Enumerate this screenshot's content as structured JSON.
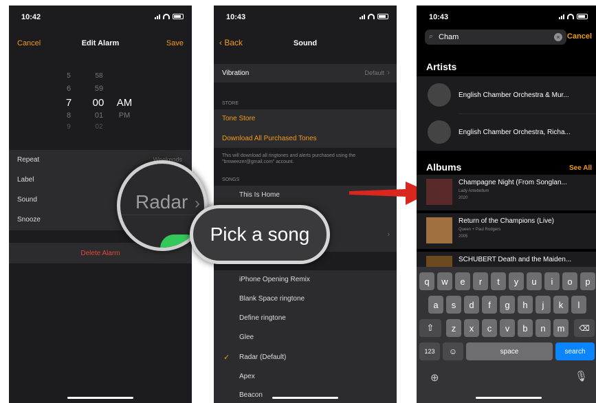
{
  "p1": {
    "time": "10:42",
    "cancel": "Cancel",
    "title": "Edit Alarm",
    "save": "Save",
    "picker": {
      "hours": [
        "5",
        "6",
        "7",
        "8",
        "9"
      ],
      "minutes": [
        "58",
        "59",
        "00",
        "01",
        "02"
      ],
      "ampm": [
        "AM",
        "PM"
      ]
    },
    "rows": [
      {
        "label": "Repeat",
        "value": "Weekends"
      },
      {
        "label": "Label",
        "value": ""
      },
      {
        "label": "Sound",
        "value": ""
      },
      {
        "label": "Snooze",
        "value": ""
      }
    ],
    "delete": "Delete Alarm",
    "magnifier": "Radar"
  },
  "p2": {
    "time": "10:43",
    "back": "Back",
    "title": "Sound",
    "vibration": "Vibration",
    "vibration_value": "Default",
    "store_header": "STORE",
    "tone_store": "Tone Store",
    "download_all": "Download All Purchased Tones",
    "note": "This will download all ringtones and alerts purchased using the \"bmweezer@gmail.com\" account.",
    "songs_header": "SONGS",
    "songs": [
      "This Is Home"
    ],
    "ringtones": [
      "iPhone Opening Remix",
      "Blank Space ringtone",
      "Define ringtone",
      "Glee",
      "Radar (Default)",
      "Apex",
      "Beacon"
    ],
    "callout": "Pick a song"
  },
  "p3": {
    "time": "10:43",
    "search_value": "Cham",
    "cancel": "Cancel",
    "artists_header": "Artists",
    "artists": [
      "English Chamber Orchestra & Mur...",
      "English Chamber Orchestra, Richa..."
    ],
    "albums_header": "Albums",
    "see_all": "See All",
    "albums": [
      {
        "title": "Champagne Night (From Songlan...",
        "sub": "Lady Antebellum",
        "year": "2020"
      },
      {
        "title": "Return of the Champions (Live)",
        "sub": "Queen + Paul Rodgers",
        "year": "2005"
      },
      {
        "title": "SCHUBERT Death and the Maiden...",
        "sub": "",
        "year": ""
      }
    ],
    "keyboard": {
      "row1": [
        "q",
        "w",
        "e",
        "r",
        "t",
        "y",
        "u",
        "i",
        "o",
        "p"
      ],
      "row2": [
        "a",
        "s",
        "d",
        "f",
        "g",
        "h",
        "j",
        "k",
        "l"
      ],
      "row3": [
        "z",
        "x",
        "c",
        "v",
        "b",
        "n",
        "m"
      ],
      "numbers": "123",
      "space": "space",
      "search": "search"
    }
  },
  "colors": {
    "accent": "#f29a1a",
    "delete": "#e0483e",
    "blue": "#0a84ff",
    "arrow": "#d9271f"
  }
}
